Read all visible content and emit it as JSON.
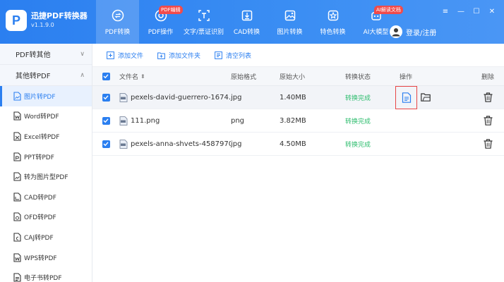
{
  "app": {
    "logo_char": "P",
    "name": "迅捷PDF转换器",
    "version": "v1.1.9.0"
  },
  "nav": [
    {
      "label": "PDF转换",
      "icon": "refresh-icon",
      "active": true,
      "badge": ""
    },
    {
      "label": "PDF操作",
      "icon": "gear-icon",
      "active": false,
      "badge": "PDF编辑"
    },
    {
      "label": "文字/票证识别",
      "icon": "text-scan-icon",
      "active": false,
      "badge": ""
    },
    {
      "label": "CAD转换",
      "icon": "cad-icon",
      "active": false,
      "badge": ""
    },
    {
      "label": "图片转换",
      "icon": "image-icon",
      "active": false,
      "badge": ""
    },
    {
      "label": "特色转换",
      "icon": "star-icon",
      "active": false,
      "badge": ""
    },
    {
      "label": "AI大模型",
      "icon": "robot-icon",
      "active": false,
      "badge": "AI解读文档"
    }
  ],
  "login": {
    "label": "登录/注册"
  },
  "window": {
    "menu": "≡",
    "minimize": "—",
    "maximize": "☐",
    "close": "✕"
  },
  "sidebar": {
    "groups": [
      {
        "label": "PDF转其他",
        "chevron": "∨"
      },
      {
        "label": "其他转PDF",
        "chevron": "∧"
      }
    ],
    "items": [
      {
        "label": "图片转PDF",
        "active": true
      },
      {
        "label": "Word转PDF",
        "active": false
      },
      {
        "label": "Excel转PDF",
        "active": false
      },
      {
        "label": "PPT转PDF",
        "active": false
      },
      {
        "label": "转为图片型PDF",
        "active": false
      },
      {
        "label": "CAD转PDF",
        "active": false
      },
      {
        "label": "OFD转PDF",
        "active": false
      },
      {
        "label": "CAJ转PDF",
        "active": false
      },
      {
        "label": "WPS转PDF",
        "active": false
      },
      {
        "label": "电子书转PDF",
        "active": false
      }
    ]
  },
  "toolbar": {
    "add_file": "添加文件",
    "add_folder": "添加文件夹",
    "clear_list": "清空列表"
  },
  "table": {
    "headers": {
      "name": "文件名",
      "sort": "⬍",
      "format": "原始格式",
      "size": "原始大小",
      "status": "转换状态",
      "ops": "操作",
      "delete": "删除"
    },
    "rows": [
      {
        "name": "pexels-david-guerrero-1674...",
        "format": "jpg",
        "size": "1.40MB",
        "status": "转换完成"
      },
      {
        "name": "111.png",
        "format": "png",
        "size": "3.82MB",
        "status": "转换完成"
      },
      {
        "name": "pexels-anna-shvets-4587970...",
        "format": "jpg",
        "size": "4.50MB",
        "status": "转换完成"
      }
    ]
  },
  "colors": {
    "accent": "#2b7ff0",
    "success": "#2ebd6e",
    "highlight": "#e84545"
  }
}
